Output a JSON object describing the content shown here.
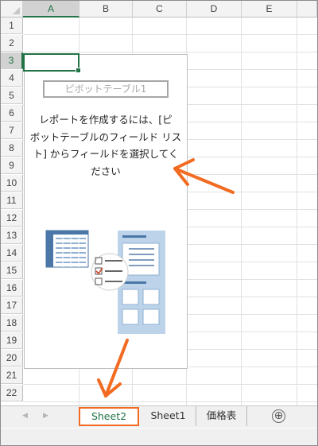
{
  "grid": {
    "columns": [
      "A",
      "B",
      "C",
      "D",
      "E"
    ],
    "rows": [
      "1",
      "2",
      "3",
      "4",
      "5",
      "6",
      "7",
      "8",
      "9",
      "10",
      "11",
      "12",
      "13",
      "14",
      "15",
      "16",
      "17",
      "18",
      "19",
      "20",
      "21",
      "22"
    ],
    "active_column": "A",
    "active_row": "3"
  },
  "pivot": {
    "title": "ピボットテーブル1",
    "message_lines": [
      "レポートを作成するには、[ピ",
      "ボットテーブルのフィールド リス",
      "ト] からフィールドを選択してく",
      "ださい"
    ]
  },
  "tabs": {
    "items": [
      {
        "label": "Sheet2",
        "active": true
      },
      {
        "label": "Sheet1",
        "active": false
      },
      {
        "label": "価格表",
        "active": false
      }
    ],
    "add_label": "⊕"
  },
  "colors": {
    "accent": "#217346",
    "annotation": "#f26b21"
  }
}
